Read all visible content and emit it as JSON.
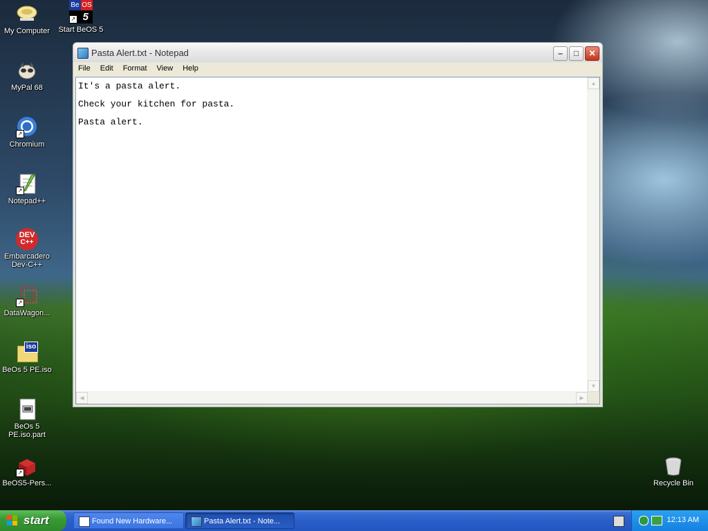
{
  "desktop": {
    "icons": [
      {
        "label": "My Computer",
        "icon": "my-computer-icon"
      },
      {
        "label": "Start BeOS 5",
        "icon": "beos-shortcut-icon",
        "icon_text": [
          "Be",
          "OS",
          "5"
        ]
      },
      {
        "label": "MyPal 68",
        "icon": "mypal-icon"
      },
      {
        "label": "Chromium",
        "icon": "chromium-icon"
      },
      {
        "label": "Notepad++",
        "icon": "notepadpp-icon"
      },
      {
        "label": "Embarcadero Dev-C++",
        "icon": "devcpp-icon",
        "icon_text": [
          "DEV",
          "C++"
        ]
      },
      {
        "label": "DataWagon...",
        "icon": "datawagon-icon"
      },
      {
        "label": "BeOs 5 PE.iso",
        "icon": "iso-file-icon",
        "icon_text": "iso"
      },
      {
        "label": "BeOs 5 PE.iso.part",
        "icon": "part-file-icon"
      },
      {
        "label": "BeOS5-Pers...",
        "icon": "beos-package-icon"
      },
      {
        "label": "Recycle Bin",
        "icon": "recycle-bin-icon"
      }
    ]
  },
  "window": {
    "title": "Pasta Alert.txt - Notepad",
    "menu": [
      "File",
      "Edit",
      "Format",
      "View",
      "Help"
    ],
    "content_lines": [
      "It's a pasta alert.",
      "Check your kitchen for pasta.",
      "Pasta alert."
    ]
  },
  "taskbar": {
    "start_label": "start",
    "tasks": [
      {
        "label": "Found New Hardware...",
        "active": false
      },
      {
        "label": "Pasta Alert.txt - Note...",
        "active": true
      }
    ],
    "clock": "12:13 AM"
  }
}
